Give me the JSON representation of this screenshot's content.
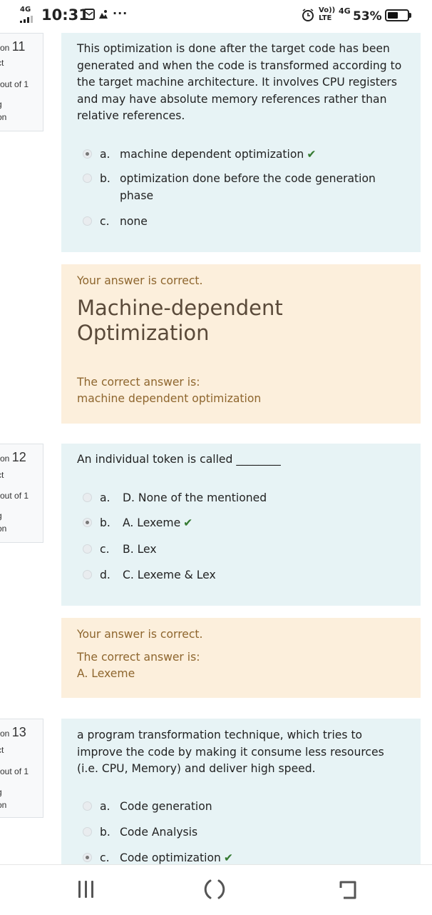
{
  "status_bar": {
    "network": "4G",
    "time": "10:31",
    "more": "···",
    "volte": "Vo))",
    "lte": "LTE",
    "network2": "4G",
    "battery": "53%",
    "battery_level": 0.53
  },
  "questions": [
    {
      "info": {
        "number_prefix": "on",
        "number": "11",
        "state": "ct",
        "marks": "out of 1",
        "flag": "g",
        "flag2": "on"
      },
      "text": "This optimization is done after the target code has been generated and when the code is transformed according to the target machine architecture. It involves CPU registers and may have absolute memory references rather than relative references.",
      "answers": [
        {
          "letter": "a.",
          "text": "machine dependent optimization",
          "selected": true,
          "correct": true
        },
        {
          "letter": "b.",
          "text": "optimization done before the code generation phase",
          "selected": false,
          "correct": false
        },
        {
          "letter": "c.",
          "text": "none",
          "selected": false,
          "correct": false
        }
      ],
      "feedback": {
        "status": "Your answer is correct.",
        "general": "Machine-dependent Optimization",
        "right_label": "The correct answer is:",
        "right_answer": "machine dependent optimization"
      }
    },
    {
      "info": {
        "number_prefix": "on",
        "number": "12",
        "state": "ct",
        "marks": "out of 1",
        "flag": "g",
        "flag2": "on"
      },
      "text": "An individual token is called ________",
      "answers": [
        {
          "letter": "a.",
          "text": "D. None of the mentioned",
          "selected": false,
          "correct": false
        },
        {
          "letter": "b.",
          "text": "A. Lexeme",
          "selected": true,
          "correct": true
        },
        {
          "letter": "c.",
          "text": "B. Lex",
          "selected": false,
          "correct": false
        },
        {
          "letter": "d.",
          "text": "C. Lexeme & Lex",
          "selected": false,
          "correct": false
        }
      ],
      "feedback": {
        "status": "Your answer is correct.",
        "right_label": "The correct answer is:",
        "right_answer": "A. Lexeme"
      }
    },
    {
      "info": {
        "number_prefix": "on",
        "number": "13",
        "state": "ct",
        "marks": "out of 1",
        "flag": "g",
        "flag2": "on"
      },
      "text": "a program transformation technique, which tries to improve the code by making it consume less resources (i.e. CPU, Memory) and deliver high speed.",
      "answers": [
        {
          "letter": "a.",
          "text": "Code generation",
          "selected": false,
          "correct": false
        },
        {
          "letter": "b.",
          "text": "Code Analysis",
          "selected": false,
          "correct": false
        },
        {
          "letter": "c.",
          "text": "Code optimization",
          "selected": true,
          "correct": true
        }
      ]
    }
  ],
  "check_mark": "✔",
  "colors": {
    "question_bg": "#e7f3f5",
    "feedback_bg": "#fcefdc",
    "feedback_text": "#8e662e",
    "check": "#357a32"
  }
}
